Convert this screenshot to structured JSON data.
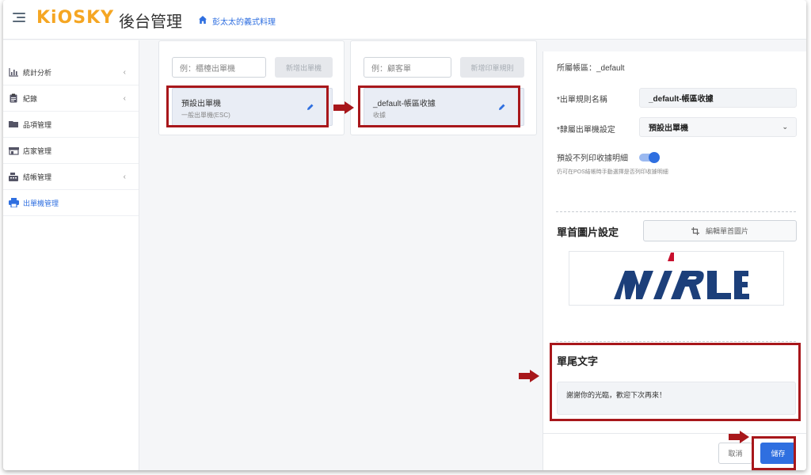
{
  "header": {
    "logo": "KiOSKY",
    "title": "後台管理",
    "store_name": "彭太太的義式料理"
  },
  "sidebar": {
    "items": [
      {
        "label": "統計分析",
        "icon": "bar-chart-icon",
        "has_chevron": true
      },
      {
        "label": "紀錄",
        "icon": "clipboard-icon",
        "has_chevron": true
      },
      {
        "label": "品項管理",
        "icon": "folder-icon",
        "has_chevron": false
      },
      {
        "label": "店家管理",
        "icon": "storefront-icon",
        "has_chevron": false
      },
      {
        "label": "結帳管理",
        "icon": "cash-register-icon",
        "has_chevron": true
      },
      {
        "label": "出單機管理",
        "icon": "printer-icon",
        "has_chevron": false,
        "active": true
      }
    ],
    "chevron": "‹"
  },
  "printers": {
    "placeholder": "例：櫃檯出單機",
    "add_label": "新增出單機",
    "item": {
      "title": "預設出單機",
      "subtitle": "一般出單機(ESC)"
    }
  },
  "rules": {
    "placeholder": "例：顧客單",
    "add_label": "新增印單規則",
    "item": {
      "title": "_default-帳區收據",
      "subtitle": "收據"
    }
  },
  "panel": {
    "account_area": "所屬帳區：_default",
    "rule_name_label": "*出單規則名稱",
    "rule_name_value": "_default-帳區收據",
    "printer_label": "*隸屬出單機設定",
    "printer_value": "預設出單機",
    "toggle_label": "預設不列印收據明細",
    "toggle_on": true,
    "toggle_hint": "仍可在POS結帳時手動選擇是否列印收據明細",
    "header_image_title": "單首圖片設定",
    "edit_image_label": "編輯單首圖片",
    "header_image_logo_text": "MIRLE",
    "footer_title": "單尾文字",
    "footer_text": "謝謝你的光臨，歡迎下次再來！",
    "cancel_label": "取消",
    "save_label": "儲存"
  },
  "colors": {
    "accent": "#2f6fe0",
    "logo": "#f5a623",
    "highlight": "#a8171b",
    "mirle_blue": "#1c3f7a",
    "mirle_red": "#c8102e"
  }
}
